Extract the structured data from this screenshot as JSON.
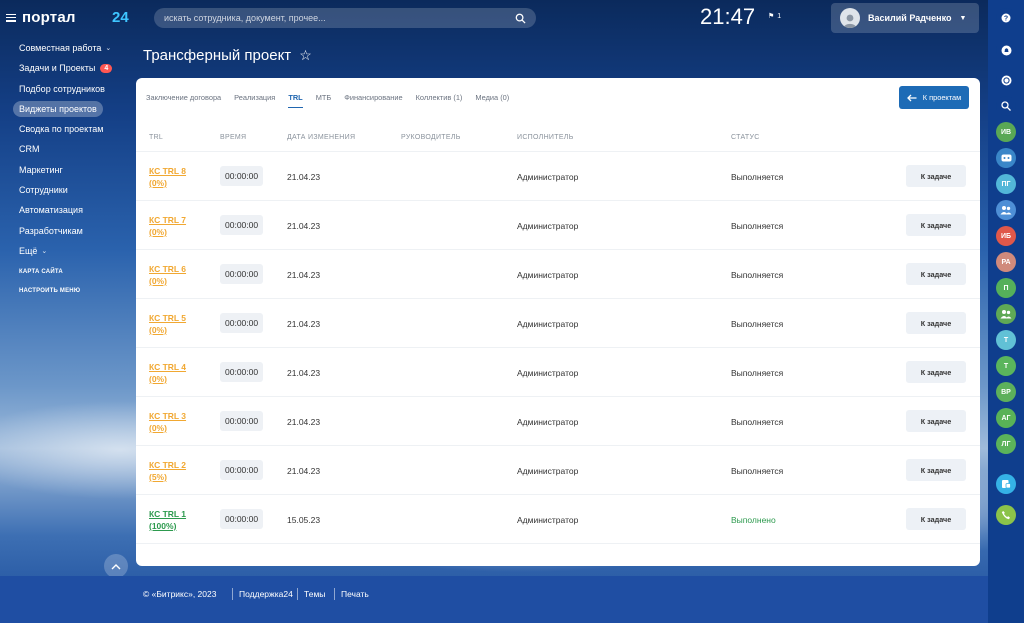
{
  "header": {
    "logo": "портал",
    "logo_num": "24",
    "search_placeholder": "искать сотрудника, документ, прочее...",
    "clock": "21:47",
    "flag_count": "1",
    "user_name": "Василий Радченко"
  },
  "menu": {
    "items": [
      {
        "label": "Совместная работа",
        "caret": "⌄"
      },
      {
        "label": "Задачи и Проекты",
        "badge": "4"
      },
      {
        "label": "Подбор сотрудников"
      },
      {
        "label": "Виджеты проектов",
        "active": true
      },
      {
        "label": "Сводка по проектам"
      },
      {
        "label": "CRM"
      },
      {
        "label": "Маркетинг"
      },
      {
        "label": "Сотрудники"
      },
      {
        "label": "Автоматизация"
      },
      {
        "label": "Разработчикам"
      },
      {
        "label": "Ещё",
        "caret": "⌄"
      }
    ],
    "sitemap": "КАРТА САЙТА",
    "configure": "НАСТРОИТЬ МЕНЮ"
  },
  "page": {
    "title": "Трансферный проект"
  },
  "tabs": [
    {
      "label": "Заключение договора"
    },
    {
      "label": "Реализация"
    },
    {
      "label": "TRL",
      "active": true
    },
    {
      "label": "МТБ"
    },
    {
      "label": "Финансирование"
    },
    {
      "label": "Коллектив (1)"
    },
    {
      "label": "Медиа (0)"
    }
  ],
  "back_button": "К проектам",
  "table": {
    "headers": [
      "TRL",
      "ВРЕМЯ",
      "ДАТА ИЗМЕНЕНИЯ",
      "РУКОВОДИТЕЛЬ",
      "ИСПОЛНИТЕЛЬ",
      "СТАТУС"
    ],
    "task_button": "К задаче",
    "rows": [
      {
        "trl_line1": "КС TRL 8",
        "trl_line2": "(0%)",
        "time": "00:00:00",
        "date": "21.04.23",
        "manager": "",
        "executor": "Администратор",
        "status": "Выполняется",
        "done": false
      },
      {
        "trl_line1": "КС TRL 7",
        "trl_line2": "(0%)",
        "time": "00:00:00",
        "date": "21.04.23",
        "manager": "",
        "executor": "Администратор",
        "status": "Выполняется",
        "done": false
      },
      {
        "trl_line1": "КС TRL 6",
        "trl_line2": "(0%)",
        "time": "00:00:00",
        "date": "21.04.23",
        "manager": "",
        "executor": "Администратор",
        "status": "Выполняется",
        "done": false
      },
      {
        "trl_line1": "КС TRL 5",
        "trl_line2": "(0%)",
        "time": "00:00:00",
        "date": "21.04.23",
        "manager": "",
        "executor": "Администратор",
        "status": "Выполняется",
        "done": false
      },
      {
        "trl_line1": "КС TRL 4",
        "trl_line2": "(0%)",
        "time": "00:00:00",
        "date": "21.04.23",
        "manager": "",
        "executor": "Администратор",
        "status": "Выполняется",
        "done": false
      },
      {
        "trl_line1": "КС TRL 3",
        "trl_line2": "(0%)",
        "time": "00:00:00",
        "date": "21.04.23",
        "manager": "",
        "executor": "Администратор",
        "status": "Выполняется",
        "done": false
      },
      {
        "trl_line1": "КС TRL 2",
        "trl_line2": "(5%)",
        "time": "00:00:00",
        "date": "21.04.23",
        "manager": "",
        "executor": "Администратор",
        "status": "Выполняется",
        "done": false
      },
      {
        "trl_line1": "КС TRL 1",
        "trl_line2": "(100%)",
        "time": "00:00:00",
        "date": "15.05.23",
        "manager": "",
        "executor": "Администратор",
        "status": "Выполнено",
        "done": true
      }
    ]
  },
  "rightbar": [
    {
      "icon": "help-icon",
      "label": "?",
      "color": "#0f3e8d"
    },
    {
      "icon": "bell-icon",
      "label": "",
      "color": "#0f3e8d"
    },
    {
      "icon": "chat-icon",
      "label": "",
      "color": "#0f3e8d"
    },
    {
      "icon": "search-icon",
      "label": "",
      "color": "#0f3e8d"
    },
    {
      "icon": "avatar",
      "label": "ИВ",
      "color": "#5aa855"
    },
    {
      "icon": "group-chat-icon",
      "label": "",
      "color": "#3a86c8"
    },
    {
      "icon": "avatar",
      "label": "ПГ",
      "color": "#52b7d8"
    },
    {
      "icon": "group-icon",
      "label": "",
      "color": "#4e8fd6"
    },
    {
      "icon": "avatar",
      "label": "ИБ",
      "color": "#e0584a"
    },
    {
      "icon": "avatar",
      "label": "РА",
      "color": "#d08a7c"
    },
    {
      "icon": "avatar",
      "label": "П",
      "color": "#55b05a"
    },
    {
      "icon": "group-icon",
      "label": "",
      "color": "#5fa956"
    },
    {
      "icon": "avatar",
      "label": "Т",
      "color": "#61c1d6"
    },
    {
      "icon": "avatar",
      "label": "Т",
      "color": "#5ab55c"
    },
    {
      "icon": "avatar",
      "label": "ВР",
      "color": "#5db05b"
    },
    {
      "icon": "avatar",
      "label": "АГ",
      "color": "#59b257"
    },
    {
      "icon": "avatar",
      "label": "ЛГ",
      "color": "#5bb35a"
    },
    {
      "icon": "add-chat-icon",
      "label": "",
      "color": "#35b2e6"
    },
    {
      "icon": "phone-icon",
      "label": "",
      "color": "#8bc34a"
    }
  ],
  "footer": {
    "copyright": "© «Битрикс», 2023",
    "support": "Поддержка24",
    "themes": "Темы",
    "print": "Печать"
  }
}
